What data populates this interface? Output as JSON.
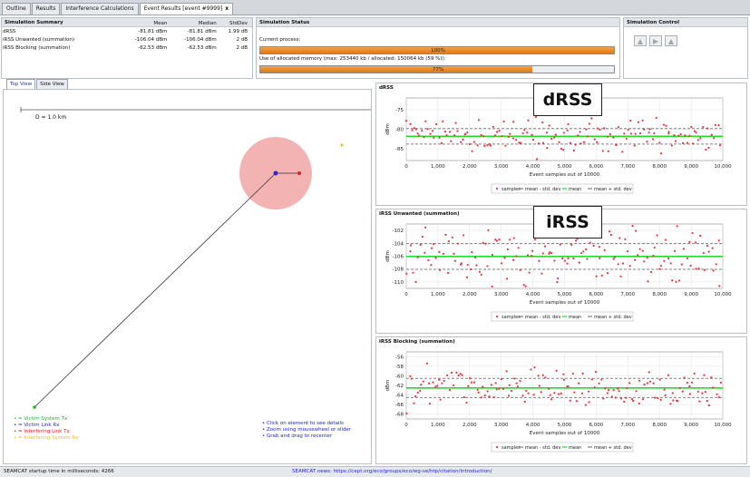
{
  "tabs": [
    {
      "label": "Outline"
    },
    {
      "label": "Results"
    },
    {
      "label": "Interference Calculations"
    },
    {
      "label": "Event Results [event #9999]",
      "close": "x"
    }
  ],
  "summary": {
    "title": "Simulation Summary",
    "headers": [
      "",
      "Mean",
      "Median",
      "StdDev"
    ],
    "rows": [
      {
        "name": "dRSS",
        "mean": "-81.81 dBm",
        "median": "-81.81 dBm",
        "stddev": "1.99 dB"
      },
      {
        "name": "iRSS Unwanted (summation)",
        "mean": "-106.04 dBm",
        "median": "-106.04 dBm",
        "stddev": "2 dB"
      },
      {
        "name": "iRSS Blocking (summation)",
        "mean": "-62.53 dBm",
        "median": "-62.53 dBm",
        "stddev": "2 dB"
      }
    ]
  },
  "status": {
    "title": "Simulation Status",
    "current_label": "Current process:",
    "current_text": "100%",
    "current_fraction": 1.0,
    "memory_label": "Use of allocated memory (max: 253440 kb / allocated: 150064 kb (59 %)):",
    "memory_text": "77%",
    "memory_fraction": 0.77
  },
  "control": {
    "title": "Simulation Control",
    "buttons": [
      {
        "icon": "run-icon",
        "glyph": "▲"
      },
      {
        "icon": "play-icon",
        "glyph": "▶"
      },
      {
        "icon": "stop-icon",
        "glyph": "▲"
      }
    ]
  },
  "view": {
    "tabs": [
      "Top View",
      "Side View"
    ],
    "scale_label": "D = 1.0 km",
    "legend": [
      {
        "label": "= Victim System Tx",
        "color": "#22b022"
      },
      {
        "label": "= Victim Link Rx",
        "color": "#2a2ad0"
      },
      {
        "label": "= Interfering Link Tx",
        "color": "#e02020"
      },
      {
        "label": "= Interfering System Rx",
        "color": "#e0c020"
      }
    ],
    "hints": [
      "Click on element to see details",
      "Zoom using mousewheel or slider",
      "Grab and drag to recenter"
    ]
  },
  "chart_data": [
    {
      "type": "scatter",
      "title": "dRSS",
      "xlabel": "Event samples out of 10000",
      "ylabel": "dBm",
      "xlim": [
        0,
        10000
      ],
      "ylim": [
        -88,
        -72
      ],
      "yticks": [
        -75,
        -80,
        -85
      ],
      "xticks": [
        0,
        1000,
        2000,
        3000,
        4000,
        5000,
        6000,
        7000,
        8000,
        9000,
        10000
      ],
      "xtick_labels": [
        "0",
        "1,000",
        "2,000",
        "3,000",
        "4,000",
        "5,000",
        "6,000",
        "7,000",
        "8,000",
        "9,000",
        "10,000"
      ],
      "mean": -81.81,
      "std": 1.99,
      "legend": [
        "samples",
        "mean - std. dev",
        "mean",
        "mean + std. dev"
      ],
      "callout": "dRSS"
    },
    {
      "type": "scatter",
      "title": "iRSS Unwanted (summation)",
      "xlabel": "Event samples out of 10000",
      "ylabel": "dBm",
      "xlim": [
        0,
        10000
      ],
      "ylim": [
        -111,
        -101
      ],
      "yticks": [
        -102,
        -104,
        -106,
        -108,
        -110
      ],
      "xticks": [
        0,
        1000,
        2000,
        3000,
        4000,
        5000,
        6000,
        7000,
        8000,
        9000,
        10000
      ],
      "xtick_labels": [
        "0",
        "1,000",
        "2,000",
        "3,000",
        "4,000",
        "5,000",
        "6,000",
        "7,000",
        "8,000",
        "9,000",
        "10,000"
      ],
      "mean": -106.04,
      "std": 2.0,
      "legend": [
        "samples",
        "mean - std. dev",
        "mean",
        "mean + std. dev"
      ],
      "callout": "iRSS"
    },
    {
      "type": "scatter",
      "title": "iRSS Blocking (summation)",
      "xlabel": "Event samples out of 10000",
      "ylabel": "dBm",
      "xlim": [
        0,
        10000
      ],
      "ylim": [
        -69,
        -55
      ],
      "yticks": [
        -56,
        -58,
        -60,
        -62,
        -64,
        -66,
        -68
      ],
      "xticks": [
        0,
        1000,
        2000,
        3000,
        4000,
        5000,
        6000,
        7000,
        8000,
        9000,
        10000
      ],
      "xtick_labels": [
        "0",
        "1,000",
        "2,000",
        "3,000",
        "4,000",
        "5,000",
        "6,000",
        "7,000",
        "8,000",
        "9,000",
        "10,000"
      ],
      "mean": -62.53,
      "std": 2.0,
      "legend": [
        "samples",
        "mean - std. dev",
        "mean",
        "mean + std. dev"
      ]
    }
  ],
  "statusbar": {
    "left": "SEAMCAT startup time in milliseconds: 4266",
    "news": "SEAMCAT news: https://cept.org/eco/groups/eco/wg-se/htp/citation/introduction/"
  },
  "colors": {
    "samples": "#e8343c",
    "mean": "#22dd22",
    "std": "#808080",
    "progress": "#e08a2a",
    "interference_area": "#f2a6a6"
  }
}
